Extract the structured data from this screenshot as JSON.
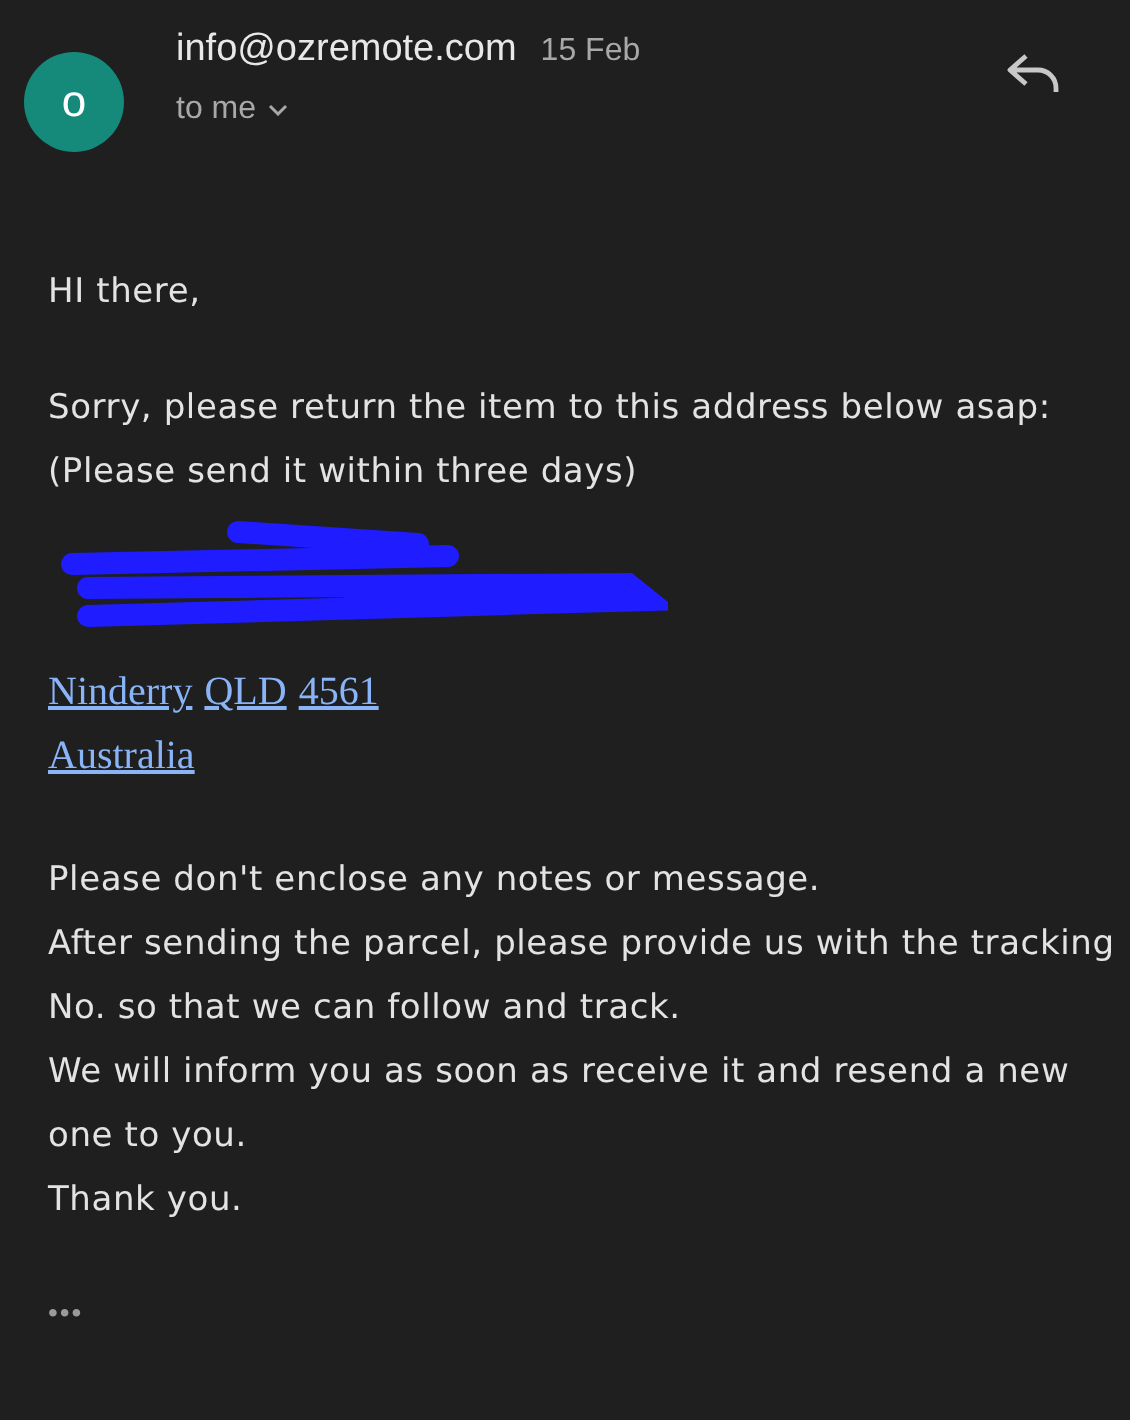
{
  "header": {
    "avatar_letter": "o",
    "sender": "info@ozremote.com",
    "date": "15 Feb",
    "recipient": "to me"
  },
  "body": {
    "greeting": "HI there,",
    "request": [
      "Sorry, please return the item to this address below asap:  (Please send it within three days)"
    ],
    "address_lines": [
      [
        "Ninderry",
        "QLD",
        "4561"
      ],
      [
        "Australia"
      ]
    ],
    "closing": [
      "Please don't enclose any notes or message.",
      "After sending the parcel, please provide us with the tracking No. so that we can follow and track.",
      "We will inform you as soon as receive it and resend a new one to you.",
      "Thank you."
    ]
  },
  "more": "•••"
}
